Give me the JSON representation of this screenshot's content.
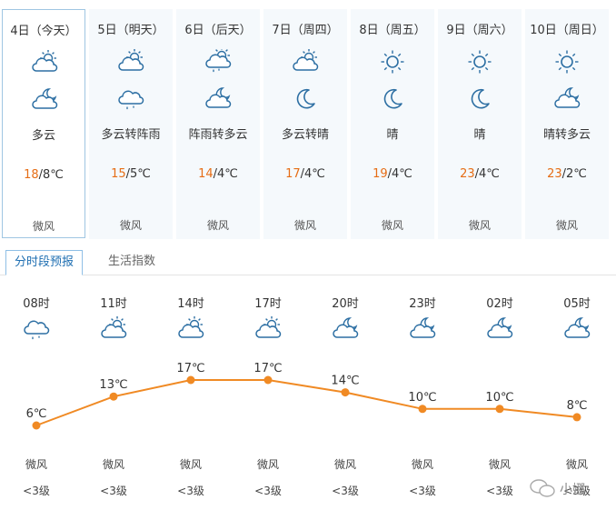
{
  "days": [
    {
      "date": "4日（今天）",
      "desc": "多云",
      "hi": "18",
      "lo": "/8℃",
      "wind": "微风",
      "icon_day": "cloudy-sun-icon",
      "icon_night": "cloudy-moon-icon",
      "selected": true
    },
    {
      "date": "5日（明天）",
      "desc": "多云转阵雨",
      "hi": "15",
      "lo": "/5℃",
      "wind": "微风",
      "icon_day": "cloudy-sun-icon",
      "icon_night": "shower-cloud-icon",
      "selected": false
    },
    {
      "date": "6日（后天）",
      "desc": "阵雨转多云",
      "hi": "14",
      "lo": "/4℃",
      "wind": "微风",
      "icon_day": "shower-sun-icon",
      "icon_night": "cloudy-moon-icon",
      "selected": false
    },
    {
      "date": "7日（周四）",
      "desc": "多云转晴",
      "hi": "17",
      "lo": "/4℃",
      "wind": "微风",
      "icon_day": "cloudy-sun-icon",
      "icon_night": "moon-icon",
      "selected": false
    },
    {
      "date": "8日（周五）",
      "desc": "晴",
      "hi": "19",
      "lo": "/4℃",
      "wind": "微风",
      "icon_day": "sun-icon",
      "icon_night": "moon-icon",
      "selected": false
    },
    {
      "date": "9日（周六）",
      "desc": "晴",
      "hi": "23",
      "lo": "/4℃",
      "wind": "微风",
      "icon_day": "sun-icon",
      "icon_night": "moon-icon",
      "selected": false
    },
    {
      "date": "10日（周日）",
      "desc": "晴转多云",
      "hi": "23",
      "lo": "/2℃",
      "wind": "微风",
      "icon_day": "sun-icon",
      "icon_night": "cloudy-moon-icon",
      "selected": false
    }
  ],
  "tabs": {
    "active": "分时段预报",
    "other": "生活指数"
  },
  "hourly": [
    {
      "time": "08时",
      "icon": "shower-cloud-icon",
      "temp": 6,
      "temp_label": "6℃",
      "wind": "微风",
      "level": "<3级"
    },
    {
      "time": "11时",
      "icon": "cloudy-sun-icon",
      "temp": 13,
      "temp_label": "13℃",
      "wind": "微风",
      "level": "<3级"
    },
    {
      "time": "14时",
      "icon": "cloudy-sun-icon",
      "temp": 17,
      "temp_label": "17℃",
      "wind": "微风",
      "level": "<3级"
    },
    {
      "time": "17时",
      "icon": "cloudy-sun-icon",
      "temp": 17,
      "temp_label": "17℃",
      "wind": "微风",
      "level": "<3级"
    },
    {
      "time": "20时",
      "icon": "cloudy-moon-icon",
      "temp": 14,
      "temp_label": "14℃",
      "wind": "微风",
      "level": "<3级"
    },
    {
      "time": "23时",
      "icon": "cloudy-moon-icon",
      "temp": 10,
      "temp_label": "10℃",
      "wind": "微风",
      "level": "<3级"
    },
    {
      "time": "02时",
      "icon": "cloudy-moon-icon",
      "temp": 10,
      "temp_label": "10℃",
      "wind": "微风",
      "level": "<3级"
    },
    {
      "time": "05时",
      "icon": "cloudy-moon-icon",
      "temp": 8,
      "temp_label": "8℃",
      "wind": "微风",
      "level": "<3级"
    }
  ],
  "chart_data": {
    "type": "line",
    "x": [
      "08时",
      "11时",
      "14时",
      "17时",
      "20时",
      "23时",
      "02时",
      "05时"
    ],
    "series": [
      {
        "values": [
          6,
          13,
          17,
          17,
          14,
          10,
          10,
          8
        ]
      }
    ],
    "line_color": "#f08a24"
  },
  "watermark": {
    "text": "小娜"
  },
  "colors": {
    "accent": "#1f6fb2",
    "hi_temp": "#e66d15",
    "icon": "#2d6fa3",
    "line": "#f08a24"
  }
}
